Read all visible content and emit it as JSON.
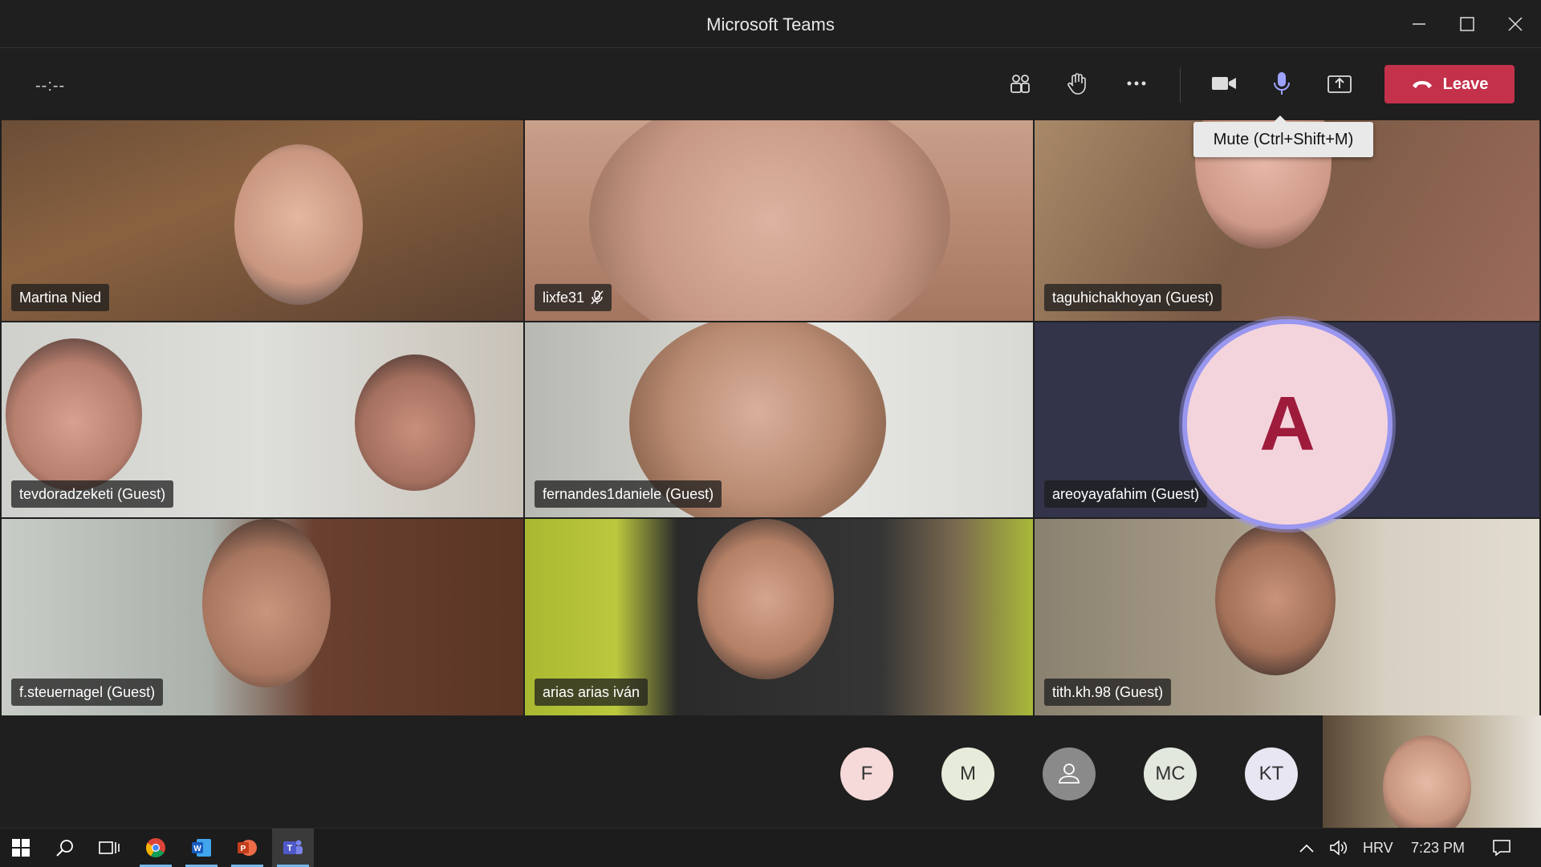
{
  "window": {
    "title": "Microsoft Teams"
  },
  "toolbar": {
    "timer": "--:--",
    "leave_label": "Leave",
    "tooltip": "Mute (Ctrl+Shift+M)"
  },
  "participants": [
    {
      "name": "Martina Nied"
    },
    {
      "name": "lixfe31"
    },
    {
      "name": "taguhichakhoyan (Guest)"
    },
    {
      "name": "tevdoradzeketi (Guest)"
    },
    {
      "name": "fernandes1daniele (Guest)"
    },
    {
      "name": "areoyayafahim (Guest)",
      "initial": "A"
    },
    {
      "name": "f.steuernagel (Guest)"
    },
    {
      "name": "arias arias iván"
    },
    {
      "name": "tith.kh.98 (Guest)"
    }
  ],
  "overflow": [
    {
      "initials": "F",
      "color": "#f6d9d9"
    },
    {
      "initials": "M",
      "color": "#e6ecd9"
    },
    {
      "initials": "",
      "color": "#8a8a8a"
    },
    {
      "initials": "MC",
      "color": "#e3e8df"
    },
    {
      "initials": "KT",
      "color": "#e8e6f2"
    }
  ],
  "taskbar": {
    "language": "HRV",
    "time": "7:23 PM"
  }
}
